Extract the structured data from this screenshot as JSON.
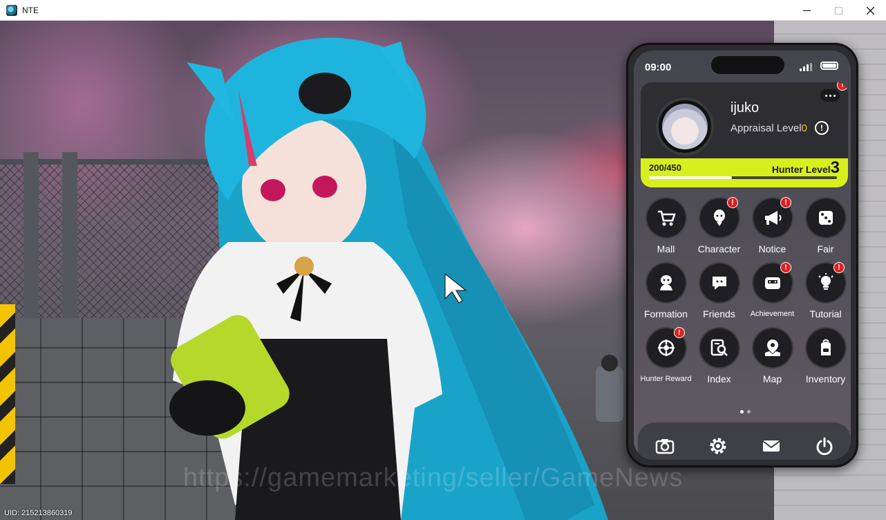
{
  "window": {
    "title": "NTE",
    "minimize_icon": "minimize-icon",
    "maximize_icon": "maximize-icon",
    "close_icon": "close-icon"
  },
  "hud": {
    "uid": "UID: 215213860319",
    "watermark": "https://gamemarketing/seller/GameNews"
  },
  "phone": {
    "status_time": "09:00",
    "profile": {
      "username": "ijuko",
      "appraisal_label": "Appraisal Level",
      "appraisal_level": "0",
      "xp_text": "200/450",
      "xp_fraction": 0.44,
      "hunter_level_label": "Hunter Level",
      "hunter_level": "3",
      "more_badge": "!"
    },
    "apps": [
      {
        "label": "Mall",
        "icon": "cart-icon",
        "badge": false
      },
      {
        "label": "Character",
        "icon": "character-icon",
        "badge": true
      },
      {
        "label": "Notice",
        "icon": "megaphone-icon",
        "badge": true
      },
      {
        "label": "Fair",
        "icon": "dice-icon",
        "badge": false
      },
      {
        "label": "Formation",
        "icon": "formation-icon",
        "badge": false
      },
      {
        "label": "Friends",
        "icon": "chat-icon",
        "badge": false
      },
      {
        "label": "Achievement",
        "icon": "achievement-icon",
        "badge": true
      },
      {
        "label": "Tutorial",
        "icon": "lightbulb-icon",
        "badge": true
      },
      {
        "label": "Hunter Reward",
        "icon": "target-icon",
        "badge": true
      },
      {
        "label": "Index",
        "icon": "index-search-icon",
        "badge": false
      },
      {
        "label": "Map",
        "icon": "map-pin-icon",
        "badge": false
      },
      {
        "label": "Inventory",
        "icon": "backpack-icon",
        "badge": false
      }
    ],
    "badge_text": "!",
    "dock": [
      "camera-icon",
      "settings-gear-icon",
      "mail-icon",
      "power-icon"
    ]
  }
}
